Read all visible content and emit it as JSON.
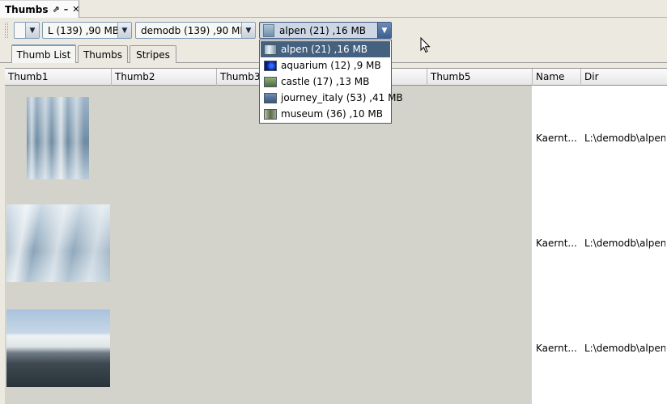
{
  "window": {
    "title": "Thumbs",
    "pin_icon": "pin-icon",
    "minimize_icon": "minimize-icon",
    "close_icon": "close-icon"
  },
  "toolbar": {
    "combo_empty": {
      "value": ""
    },
    "combo_drive": {
      "value": "L (139) ,90 MB"
    },
    "combo_db": {
      "value": "demodb (139) ,90 MB"
    },
    "combo_album": {
      "value": "alpen (21) ,16 MB",
      "expanded": true
    }
  },
  "tabs": [
    {
      "label": "Thumb List",
      "selected": true
    },
    {
      "label": "Thumbs",
      "selected": false
    },
    {
      "label": "Stripes",
      "selected": false
    }
  ],
  "table": {
    "columns": [
      "Thumb1",
      "Thumb2",
      "Thumb3",
      "Thumb4",
      "Thumb5",
      "Name",
      "Dir"
    ],
    "rows": [
      {
        "name": "Kaernt...",
        "dir": "L:\\demodb\\alpen",
        "thumb": "ice-portrait"
      },
      {
        "name": "Kaernt...",
        "dir": "L:\\demodb\\alpen",
        "thumb": "ice-landscape"
      },
      {
        "name": "Kaernt...",
        "dir": "L:\\demodb\\alpen",
        "thumb": "snowy-mountain"
      }
    ]
  },
  "dropdown": {
    "items": [
      {
        "label": "alpen (21) ,16 MB",
        "selected": true,
        "icon": "alpen-thumb"
      },
      {
        "label": "aquarium (12) ,9 MB",
        "selected": false,
        "icon": "aquarium-thumb"
      },
      {
        "label": "castle (17) ,13 MB",
        "selected": false,
        "icon": "castle-thumb"
      },
      {
        "label": "journey_italy (53) ,41 MB",
        "selected": false,
        "icon": "journey-thumb"
      },
      {
        "label": "museum (36) ,10 MB",
        "selected": false,
        "icon": "museum-thumb"
      }
    ]
  },
  "colors": {
    "selection": "#44617f",
    "thumb_area": "#d4d3cb",
    "panel_bg": "#ece9e1"
  }
}
